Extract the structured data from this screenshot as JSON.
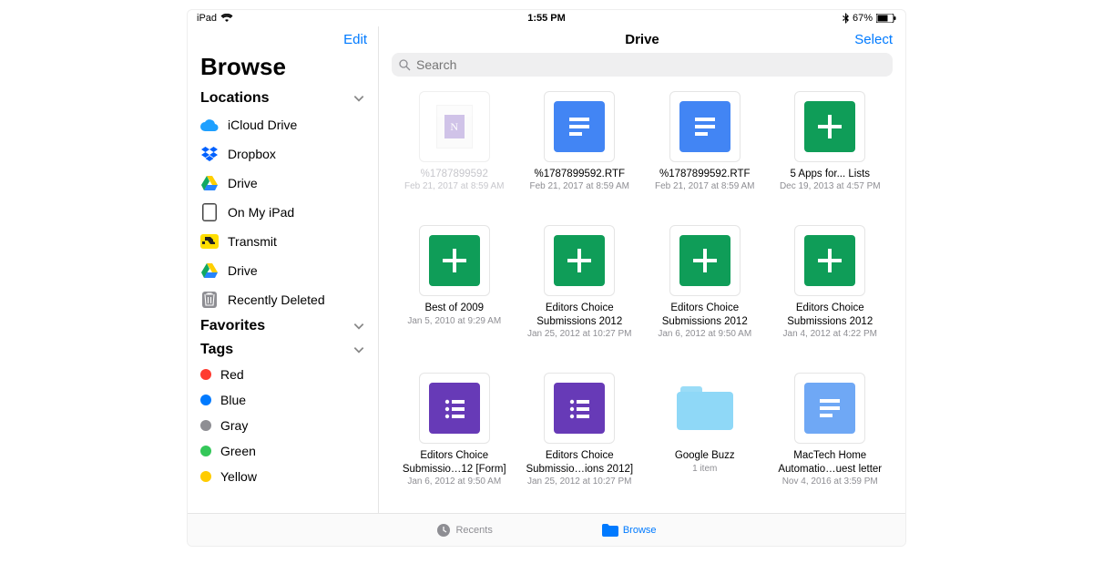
{
  "status": {
    "device": "iPad",
    "time": "1:55 PM",
    "battery_pct": "67%"
  },
  "sidebar": {
    "edit": "Edit",
    "title": "Browse",
    "sections": {
      "locations": "Locations",
      "favorites": "Favorites",
      "tags": "Tags"
    },
    "locations": [
      {
        "label": "iCloud Drive",
        "icon": "icloud"
      },
      {
        "label": "Dropbox",
        "icon": "dropbox"
      },
      {
        "label": "Drive",
        "icon": "gdrive"
      },
      {
        "label": "On My iPad",
        "icon": "ipad"
      },
      {
        "label": "Transmit",
        "icon": "transmit"
      },
      {
        "label": "Drive",
        "icon": "gdrive"
      },
      {
        "label": "Recently Deleted",
        "icon": "trash"
      }
    ],
    "tags": [
      {
        "label": "Red",
        "color": "#ff3b30"
      },
      {
        "label": "Blue",
        "color": "#007aff"
      },
      {
        "label": "Gray",
        "color": "#8e8e93"
      },
      {
        "label": "Green",
        "color": "#34c759"
      },
      {
        "label": "Yellow",
        "color": "#ffcc00"
      }
    ]
  },
  "main": {
    "title": "Drive",
    "select": "Select",
    "search_placeholder": "Search"
  },
  "files": [
    {
      "name": "%1787899592",
      "meta": "Feb 21, 2017 at 8:59 AM",
      "type": "onenote",
      "dim": true
    },
    {
      "name": "%1787899592.RTF",
      "meta": "Feb 21, 2017 at 8:59 AM",
      "type": "docs"
    },
    {
      "name": "%1787899592.RTF",
      "meta": "Feb 21, 2017 at 8:59 AM",
      "type": "docs"
    },
    {
      "name": "5 Apps for... Lists",
      "meta": "Dec 19, 2013 at 4:57 PM",
      "type": "sheets"
    },
    {
      "name": "Best of 2009",
      "meta": "Jan 5, 2010 at 9:29 AM",
      "type": "sheets"
    },
    {
      "name": "Editors Choice Submissions 2012",
      "meta": "Jan 25, 2012 at 10:27 PM",
      "type": "sheets"
    },
    {
      "name": "Editors Choice Submissions 2012",
      "meta": "Jan 6, 2012 at 9:50 AM",
      "type": "sheets"
    },
    {
      "name": "Editors Choice Submissions 2012",
      "meta": "Jan 4, 2012 at 4:22 PM",
      "type": "sheets"
    },
    {
      "name": "Editors Choice Submissio…12 [Form]",
      "meta": "Jan 6, 2012 at 9:50 AM",
      "type": "forms"
    },
    {
      "name": "Editors Choice Submissio…ions 2012]",
      "meta": "Jan 25, 2012 at 10:27 PM",
      "type": "forms"
    },
    {
      "name": "Google Buzz",
      "meta": "1 item",
      "type": "folder"
    },
    {
      "name": "MacTech Home Automatio…uest letter",
      "meta": "Nov 4, 2016 at 3:59 PM",
      "type": "docs-light"
    }
  ],
  "tabs": {
    "recents": "Recents",
    "browse": "Browse"
  }
}
